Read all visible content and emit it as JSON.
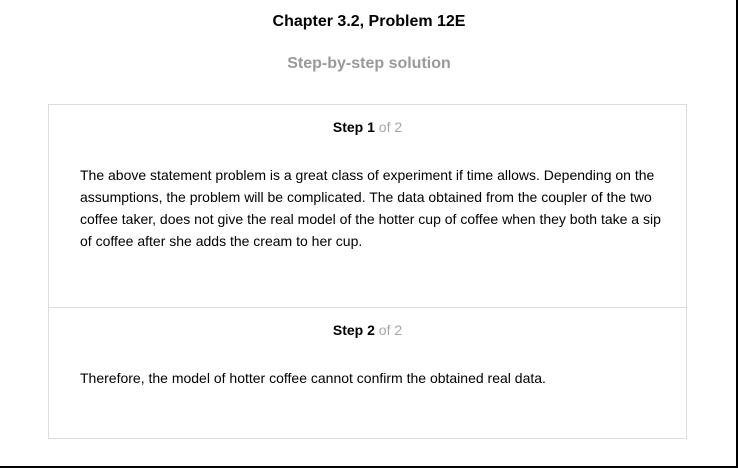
{
  "page": {
    "title": "Chapter 3.2, Problem 12E",
    "subtitle": "Step-by-step solution"
  },
  "steps": [
    {
      "label": "Step",
      "number": "1",
      "of_text": "of 2",
      "body": "The above statement problem is a great class of experiment if time allows. Depending on the assumptions, the problem will be complicated. The data obtained from the coupler of the two coffee taker, does not give the real model of the hotter cup of coffee when they both take a sip of coffee after she adds the cream to her cup."
    },
    {
      "label": "Step",
      "number": "2",
      "of_text": "of 2",
      "body": "Therefore, the model of hotter coffee cannot confirm the obtained real data."
    }
  ]
}
